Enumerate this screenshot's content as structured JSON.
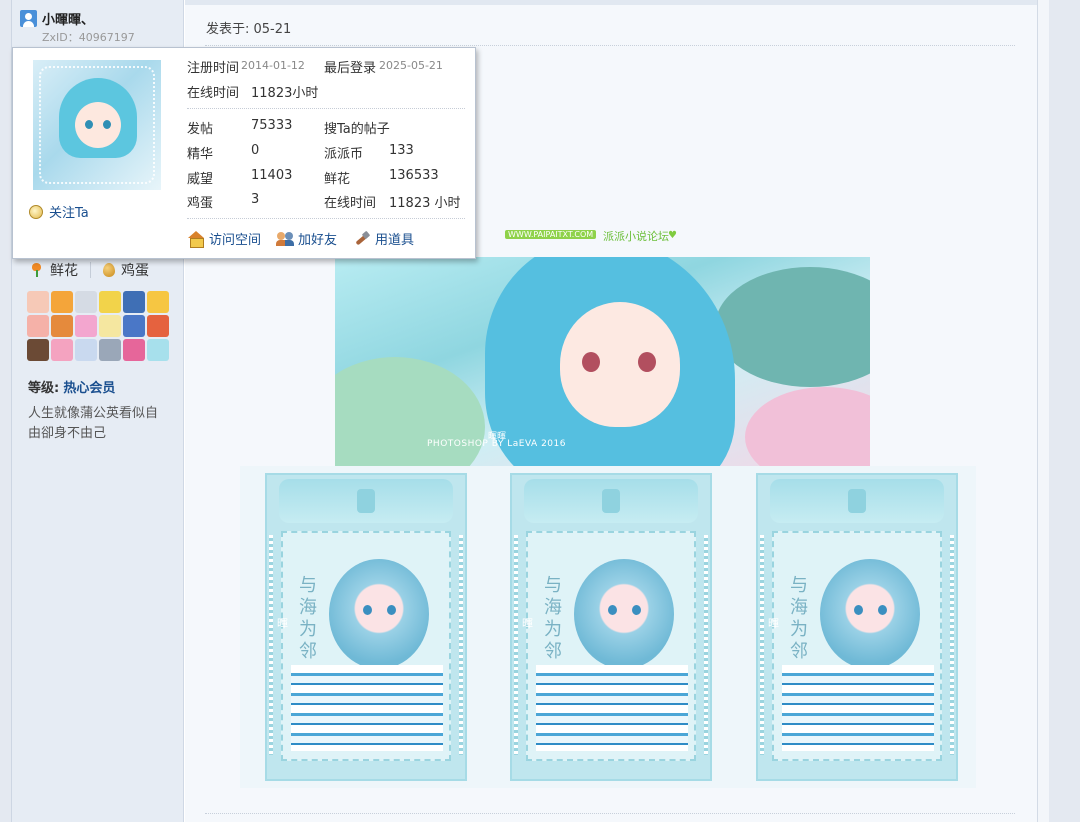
{
  "author": {
    "username": "小暉暉、",
    "zxid": "ZxID：40967197",
    "follow_label": "关注Ta",
    "flower_label": "鲜花",
    "egg_label": "鸡蛋",
    "level_label": "等级:",
    "level_value": "热心会员",
    "signature": "人生就像蒲公英看似自由卻身不由己"
  },
  "post": {
    "posted_at": "发表于: 05-21",
    "watermark_url": "WWW.PAIPAITXT.COM",
    "forum_name": "派派小说论坛",
    "banner_caption": "PHOTOSHOP BY LaEVA 2016",
    "banner_sig": "暉暉",
    "card_vertical_text": "与海为邻",
    "card_small_text": "暉"
  },
  "popup": {
    "reg_label": "注册时间",
    "reg_value": "2014-01-12",
    "last_login_label": "最后登录",
    "last_login_value": "2025-05-21",
    "online_label": "在线时间",
    "online_value": "11823小时",
    "stats": {
      "posts_label": "发帖",
      "posts_value": "75333",
      "search_posts_link": "搜Ta的帖子",
      "digest_label": "精华",
      "digest_value": "0",
      "coins_label": "派派币",
      "coins_value": "133",
      "prestige_label": "威望",
      "prestige_value": "11403",
      "flowers_label": "鲜花",
      "flowers_value": "136533",
      "eggs_label": "鸡蛋",
      "eggs_value": "3",
      "online2_label": "在线时间",
      "online2_value": "11823 小时"
    },
    "actions": {
      "visit_space": "访问空间",
      "add_friend": "加好友",
      "use_item": "用道具"
    }
  },
  "icons": {
    "user": "user-icon",
    "follow": "bulb-icon",
    "visit": "home-icon",
    "friend": "friends-icon",
    "item": "tool-icon",
    "flower": "flower-icon",
    "egg": "egg-icon"
  },
  "colors": {
    "link": "#1a4f8f",
    "sidebar_bg": "#e6ecf4",
    "main_bg": "#f5f8fc",
    "accent_green": "#8fd24a"
  }
}
